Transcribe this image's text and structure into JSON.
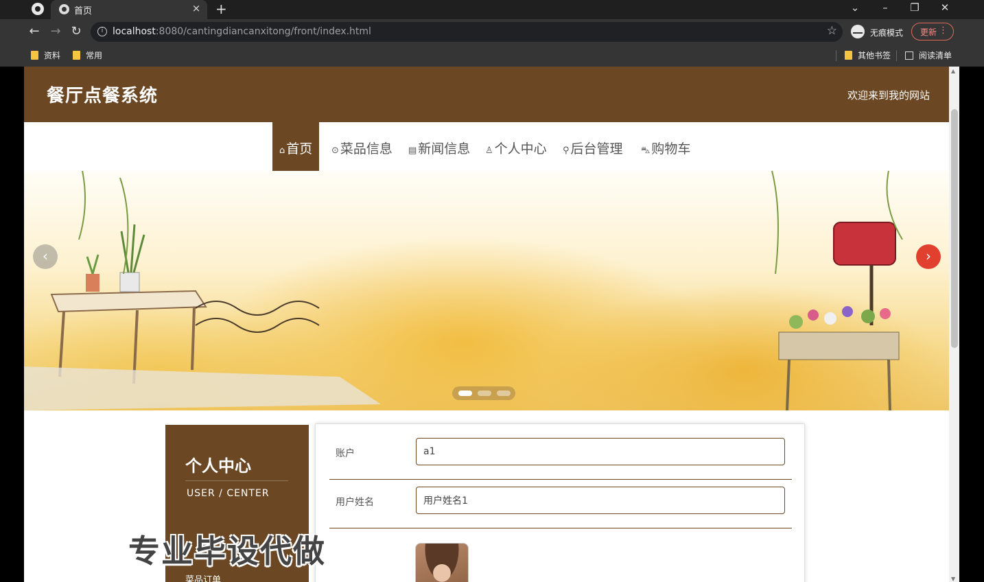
{
  "browser": {
    "tab_title": "首页",
    "tab_close": "×",
    "new_tab": "+",
    "url_host": "localhost",
    "url_rest": ":8080/cantingdiancanxitong/front/index.html",
    "incognito_label": "无痕模式",
    "update_label": "更新",
    "bookmarks": [
      "资料",
      "常用"
    ],
    "other_bookmarks": "其他书签",
    "reading_list": "阅读清单"
  },
  "site": {
    "title": "餐厅点餐系统",
    "welcome": "欢迎来到我的网站"
  },
  "nav": {
    "items": [
      {
        "icon": "⌂",
        "label": "首页",
        "active": true
      },
      {
        "icon": "⊙",
        "label": "菜品信息"
      },
      {
        "icon": "▤",
        "label": "新闻信息"
      },
      {
        "icon": "♙",
        "label": "个人中心"
      },
      {
        "icon": "⚲",
        "label": "后台管理"
      },
      {
        "icon": "⛍",
        "label": "购物车"
      }
    ]
  },
  "banner": {
    "slide_count": 3,
    "active_slide": 0,
    "prev": "‹",
    "next": "›"
  },
  "sidebar": {
    "title": "个人中心",
    "subtitle": "USER / CENTER",
    "menu_item": "菜品订单"
  },
  "watermark": "专业毕设代做",
  "form": {
    "fields": [
      {
        "label": "账户",
        "value": "a1"
      },
      {
        "label": "用户姓名",
        "value": "用户姓名1"
      }
    ]
  },
  "colors": {
    "brand": "#6b4723",
    "accent": "#e0402d"
  }
}
